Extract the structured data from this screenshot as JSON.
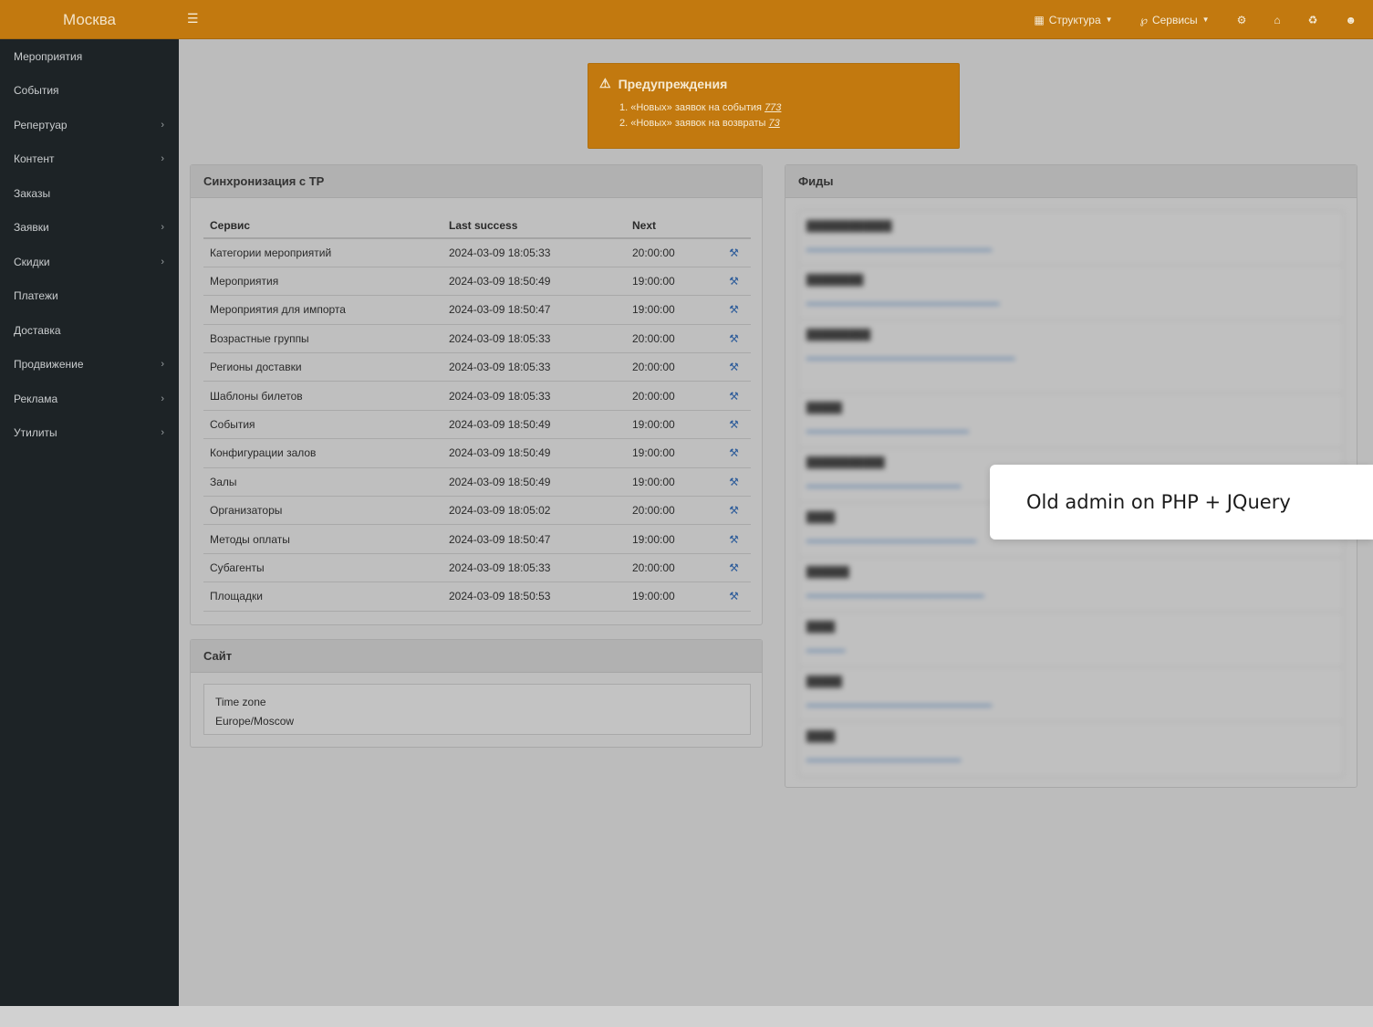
{
  "brand": "Москва",
  "topnav": {
    "structure": "Структура",
    "services": "Сервисы"
  },
  "sidebar": {
    "items": [
      {
        "label": "Мероприятия",
        "chevron": false
      },
      {
        "label": "События",
        "chevron": false
      },
      {
        "label": "Репертуар",
        "chevron": true
      },
      {
        "label": "Контент",
        "chevron": true
      },
      {
        "label": "Заказы",
        "chevron": false
      },
      {
        "label": "Заявки",
        "chevron": true
      },
      {
        "label": "Скидки",
        "chevron": true
      },
      {
        "label": "Платежи",
        "chevron": false
      },
      {
        "label": "Доставка",
        "chevron": false
      },
      {
        "label": "Продвижение",
        "chevron": true
      },
      {
        "label": "Реклама",
        "chevron": true
      },
      {
        "label": "Утилиты",
        "chevron": true
      }
    ]
  },
  "alert": {
    "title": "Предупреждения",
    "items": [
      {
        "text": "1. «Новых» заявок на события ",
        "link": "773"
      },
      {
        "text": "2. «Новых» заявок на возвраты ",
        "link": "73"
      }
    ]
  },
  "sync": {
    "title": "Синхронизация с ТР",
    "columns": [
      "Сервис",
      "Last success",
      "Next"
    ],
    "rows": [
      [
        "Категории мероприятий",
        "2024-03-09 18:05:33",
        "20:00:00"
      ],
      [
        "Мероприятия",
        "2024-03-09 18:50:49",
        "19:00:00"
      ],
      [
        "Мероприятия для импорта",
        "2024-03-09 18:50:47",
        "19:00:00"
      ],
      [
        "Возрастные группы",
        "2024-03-09 18:05:33",
        "20:00:00"
      ],
      [
        "Регионы доставки",
        "2024-03-09 18:05:33",
        "20:00:00"
      ],
      [
        "Шаблоны билетов",
        "2024-03-09 18:05:33",
        "20:00:00"
      ],
      [
        "События",
        "2024-03-09 18:50:49",
        "19:00:00"
      ],
      [
        "Конфигурации залов",
        "2024-03-09 18:50:49",
        "19:00:00"
      ],
      [
        "Залы",
        "2024-03-09 18:50:49",
        "19:00:00"
      ],
      [
        "Организаторы",
        "2024-03-09 18:05:02",
        "20:00:00"
      ],
      [
        "Методы оплаты",
        "2024-03-09 18:50:47",
        "19:00:00"
      ],
      [
        "Субагенты",
        "2024-03-09 18:05:33",
        "20:00:00"
      ],
      [
        "Площадки",
        "2024-03-09 18:50:53",
        "19:00:00"
      ]
    ]
  },
  "site": {
    "title": "Сайт",
    "tz_label": "Time zone",
    "tz_value": "Europe/Moscow"
  },
  "feeds": {
    "title": "Фиды"
  },
  "callout": "Old admin on PHP + JQuery",
  "colors": {
    "accent": "#c2790f",
    "sidebar": "#1d2326",
    "link": "#2d5c9a"
  }
}
